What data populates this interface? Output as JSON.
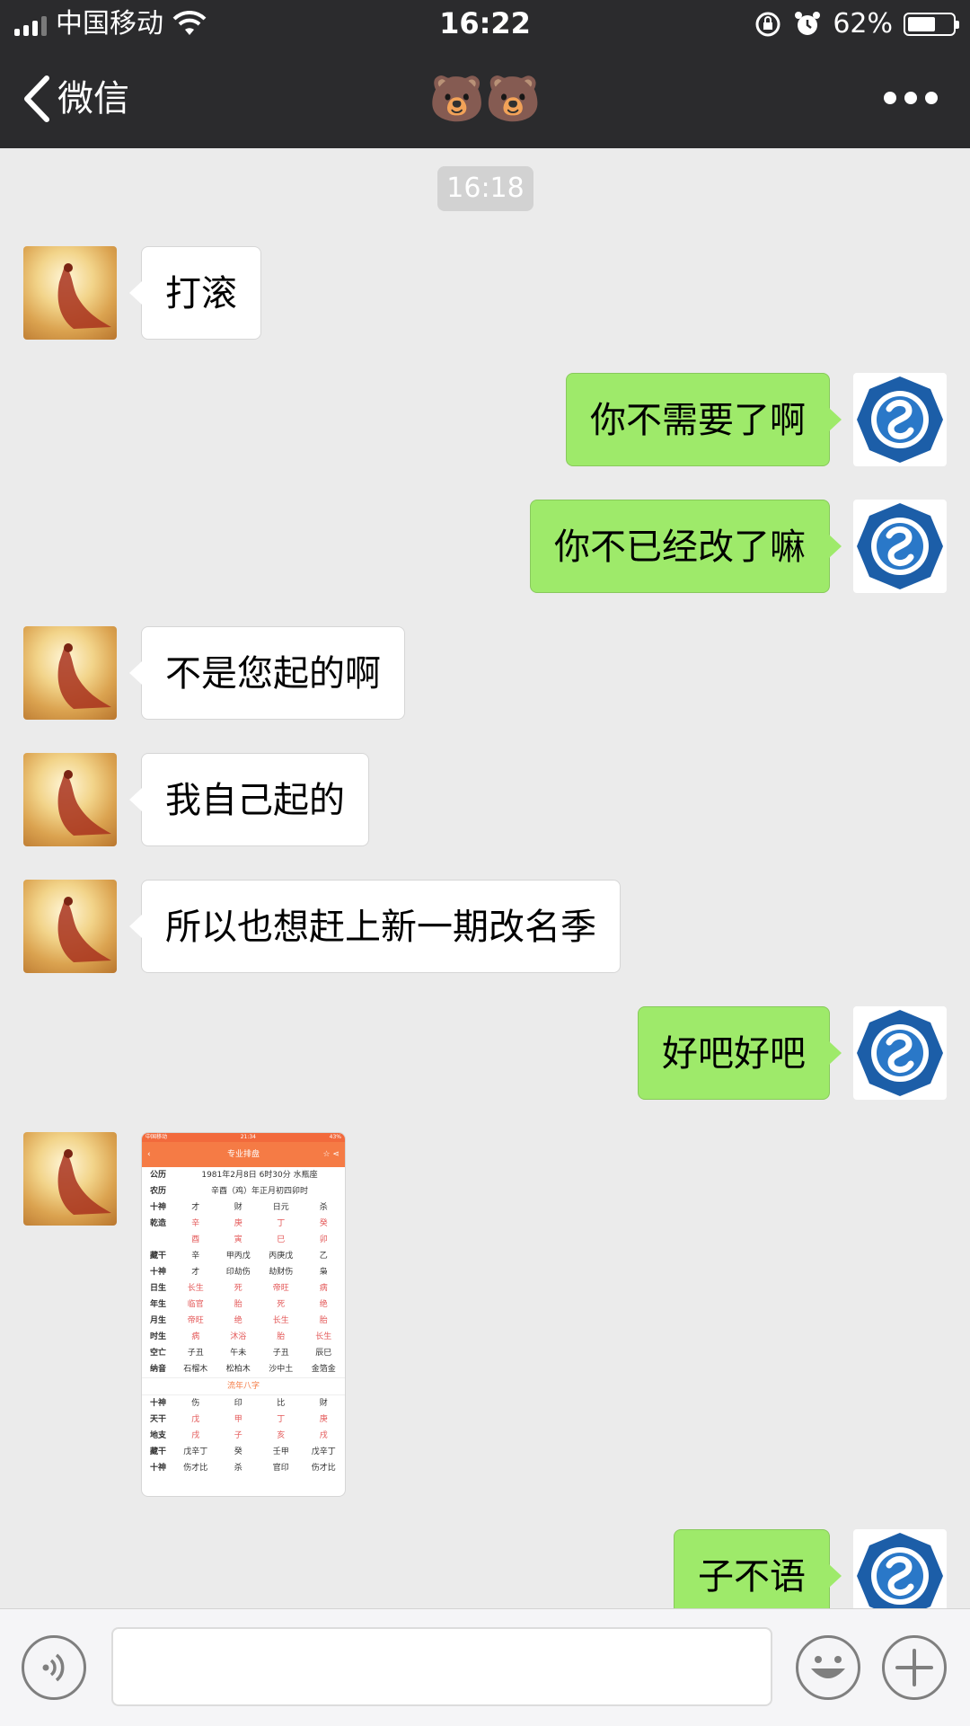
{
  "status_bar": {
    "carrier": "中国移动",
    "time": "16:22",
    "battery_percent": "62%",
    "battery_level": 0.62,
    "icons": [
      "signal-icon",
      "wifi-icon",
      "rotation-lock-icon",
      "alarm-icon",
      "battery-icon"
    ]
  },
  "nav": {
    "back_label": "微信",
    "title": "🐻🐻"
  },
  "chat": {
    "timestamp": "16:18",
    "messages": [
      {
        "side": "in",
        "text": "打滚"
      },
      {
        "side": "out",
        "text": "你不需要了啊"
      },
      {
        "side": "out",
        "text": "你不已经改了嘛"
      },
      {
        "side": "in",
        "text": "不是您起的啊"
      },
      {
        "side": "in",
        "text": "我自己起的"
      },
      {
        "side": "in",
        "text": "所以也想赶上新一期改名季"
      },
      {
        "side": "out",
        "text": "好吧好吧"
      },
      {
        "side": "out",
        "text": "子不语"
      }
    ],
    "image_message": {
      "status_left": "中国移动",
      "status_time": "21:34",
      "status_right": "43%",
      "title": "专业排盘",
      "gongli_label": "公历",
      "gongli_value": "1981年2月8日 6时30分 水瓶座",
      "nongli_label": "农历",
      "nongli_value": "辛酉（鸡）年正月初四卯时",
      "divider": "流年八字",
      "rows_top": [
        {
          "label": "十神",
          "cells": [
            "才",
            "财",
            "日元",
            "杀"
          ]
        },
        {
          "label": "乾造",
          "cells": [
            "辛",
            "庚",
            "丁",
            "癸"
          ]
        },
        {
          "label": "",
          "cells": [
            "酉",
            "寅",
            "巳",
            "卯"
          ]
        },
        {
          "label": "藏干",
          "cells": [
            "辛",
            "甲丙戊",
            "丙庚戊",
            "乙"
          ]
        },
        {
          "label": "十神",
          "cells": [
            "才",
            "印劫伤",
            "劫财伤",
            "枭"
          ]
        },
        {
          "label": "日生",
          "cells": [
            "长生",
            "死",
            "帝旺",
            "病"
          ]
        },
        {
          "label": "年生",
          "cells": [
            "临官",
            "胎",
            "死",
            "绝"
          ]
        },
        {
          "label": "月生",
          "cells": [
            "帝旺",
            "绝",
            "长生",
            "胎"
          ]
        },
        {
          "label": "时生",
          "cells": [
            "病",
            "沐浴",
            "胎",
            "长生"
          ]
        },
        {
          "label": "空亡",
          "cells": [
            "子丑",
            "午未",
            "子丑",
            "辰巳"
          ]
        },
        {
          "label": "纳音",
          "cells": [
            "石榴木",
            "松柏木",
            "沙中土",
            "金箔金"
          ]
        }
      ],
      "rows_bottom": [
        {
          "label": "十神",
          "cells": [
            "伤",
            "印",
            "比",
            "财"
          ]
        },
        {
          "label": "天干",
          "cells": [
            "戊",
            "甲",
            "丁",
            "庚"
          ]
        },
        {
          "label": "地支",
          "cells": [
            "戌",
            "子",
            "亥",
            "戌"
          ]
        },
        {
          "label": "藏干",
          "cells": [
            "戊辛丁",
            "癸",
            "壬甲",
            "戊辛丁"
          ]
        },
        {
          "label": "十神",
          "cells": [
            "伤才比",
            "杀",
            "官印",
            "伤才比"
          ]
        }
      ]
    }
  },
  "input_bar": {
    "value": "",
    "placeholder": ""
  },
  "colors": {
    "header_bg": "#2b2b2d",
    "chat_bg": "#ebebeb",
    "outgoing_bubble": "#9eea6a",
    "incoming_bubble": "#ffffff",
    "accent_orange": "#f57b45"
  }
}
